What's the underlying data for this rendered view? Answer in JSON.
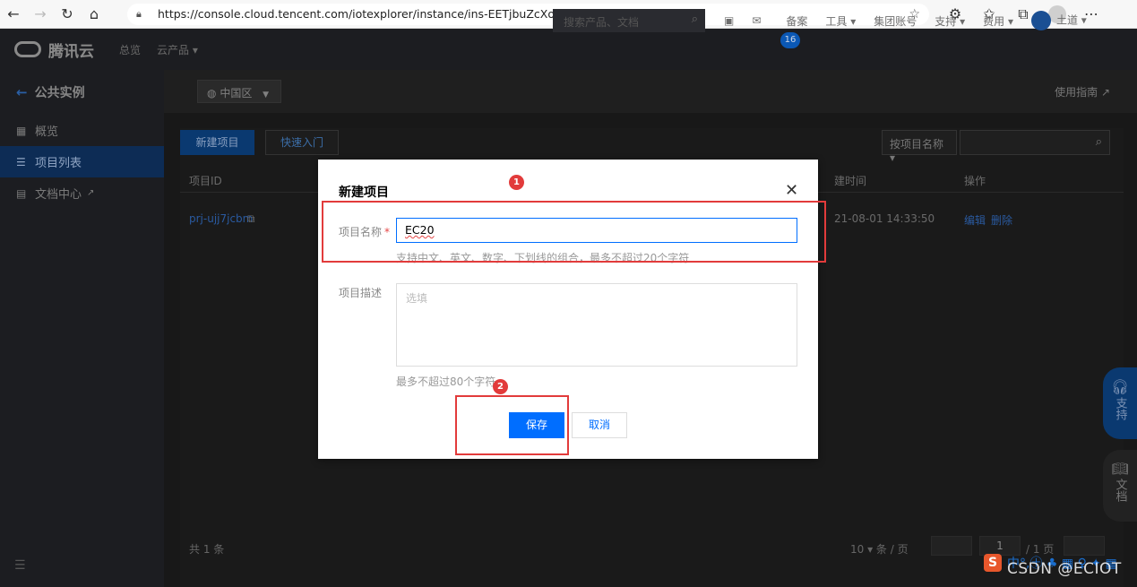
{
  "browser": {
    "url": "https://console.cloud.tencent.com/iotexplorer/instance/ins-EETjbuZcXo"
  },
  "topbar": {
    "brand": "腾讯云",
    "nav_overview": "总览",
    "nav_products": "云产品 ▾",
    "search_placeholder": "搜索产品、文档",
    "notification_count": "16",
    "items": [
      "备案",
      "工具 ▾",
      "集团账号",
      "支持 ▾",
      "费用 ▾"
    ],
    "user": "土道 ▾"
  },
  "sidebar": {
    "title": "公共实例",
    "items": [
      {
        "label": "概览",
        "icon": "grid-icon"
      },
      {
        "label": "项目列表",
        "icon": "list-icon"
      },
      {
        "label": "文档中心",
        "icon": "doc-icon"
      }
    ]
  },
  "main": {
    "region": "中国区",
    "guide": "使用指南",
    "new_project": "新建项目",
    "quick_start": "快速入门",
    "search_by": "按项目名称 ▾",
    "columns": [
      "项目ID",
      "建时间",
      "操作"
    ],
    "rows": [
      {
        "id": "prj-ujj7jcbm",
        "time": "21-08-01 14:33:50",
        "edit": "编辑",
        "delete": "删除"
      }
    ],
    "total": "共 1 条",
    "page_size": "10 ▾ 条 / 页",
    "page": "1",
    "pages": "/ 1 页"
  },
  "floating": {
    "support": "支持",
    "docs": "文档"
  },
  "dialog": {
    "title": "新建项目",
    "name_label": "项目名称",
    "name_value": "EC20",
    "name_hint": "支持中文、英文、数字、下划线的组合，最多不超过20个字符",
    "desc_label": "项目描述",
    "desc_placeholder": "选填",
    "desc_hint": "最多不超过80个字符",
    "save": "保存",
    "cancel": "取消"
  },
  "annotations": {
    "step1": "1",
    "step2": "2",
    "color": "#e23b3b"
  },
  "watermark": "CSDN @ECIOT",
  "ime": "中°,㊉ ♣ ▦ ♀ ✦ ▦"
}
